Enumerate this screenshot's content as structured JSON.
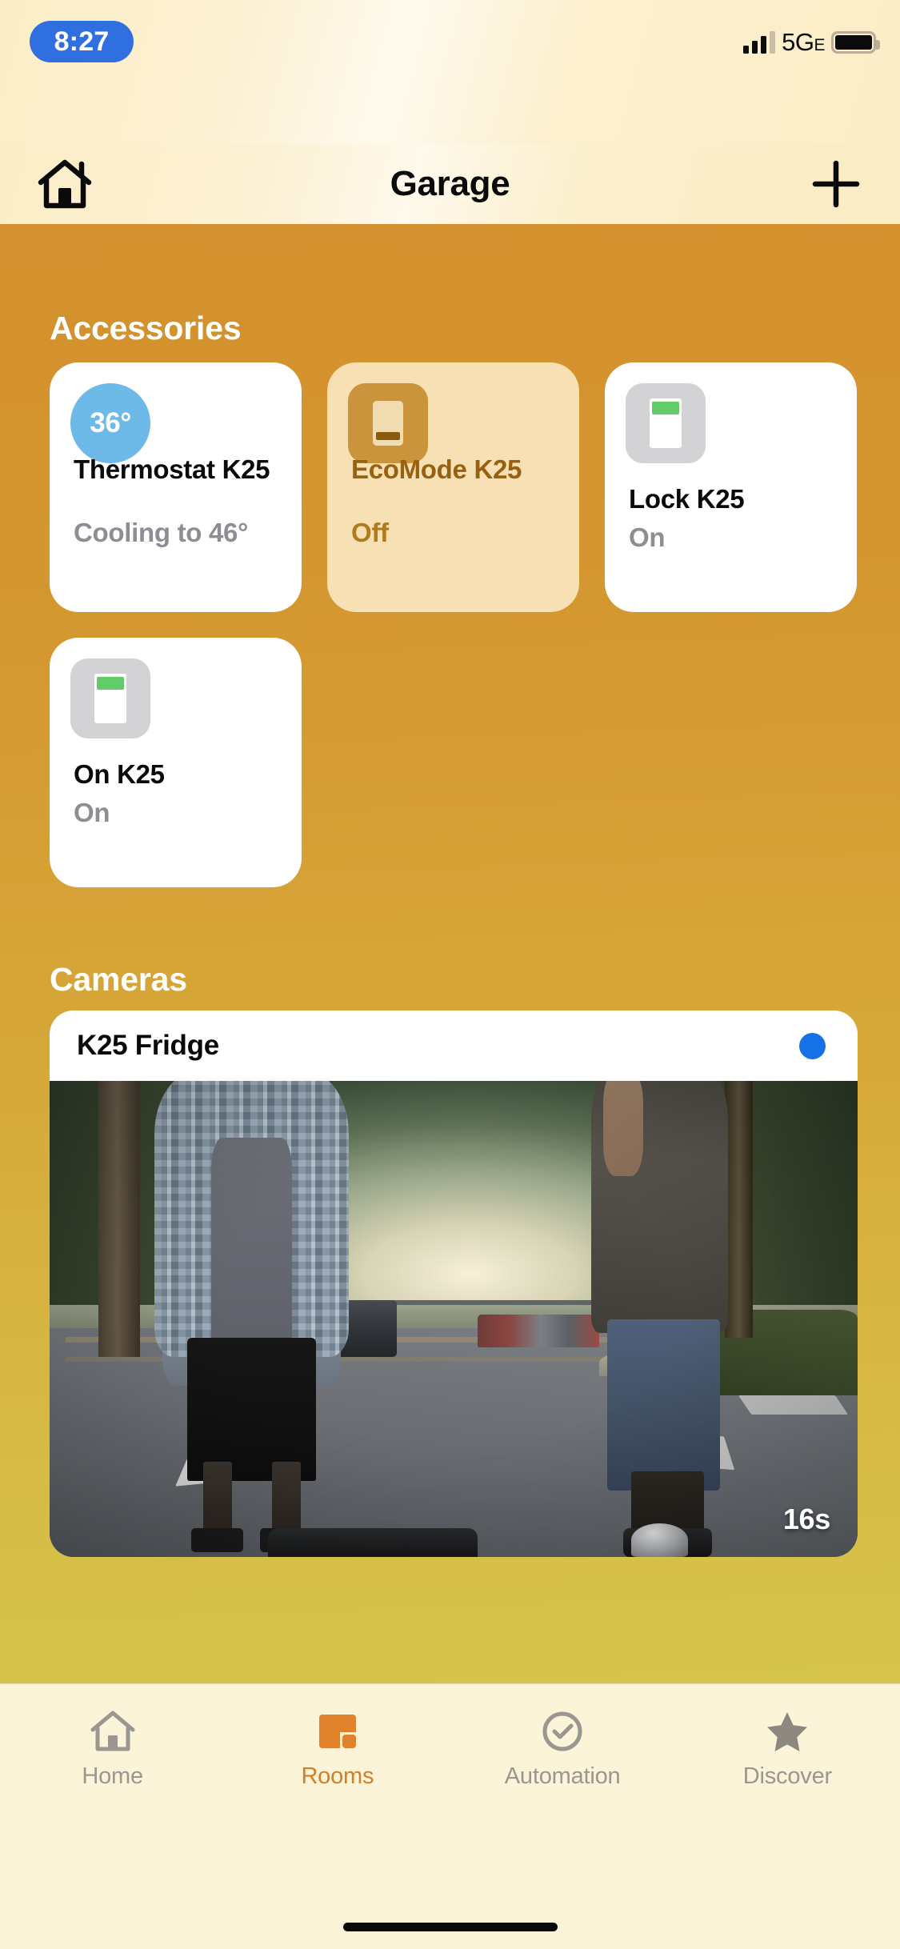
{
  "status_bar": {
    "time": "8:27",
    "time_pill_color": "#2F6FE0",
    "network": "5G",
    "network_suffix": "E",
    "signal_icon": "cellular-signal-icon",
    "battery_icon": "battery-full-icon"
  },
  "nav": {
    "home_icon": "house-icon",
    "title": "Garage",
    "add_icon": "plus-icon"
  },
  "sections": {
    "accessories_title": "Accessories",
    "cameras_title": "Cameras"
  },
  "accessories": [
    {
      "icon": "thermostat-temperature-icon",
      "icon_type": "temp",
      "temperature": "36°",
      "accent": "#6DB9E8",
      "name": "Thermostat K25",
      "status": "Cooling to 46°",
      "active": false,
      "lines": 2
    },
    {
      "icon": "ecomode-appliance-icon",
      "icon_type": "eco",
      "accent": "#C9943B",
      "name": "EcoMode K25",
      "status": "Off",
      "active": true,
      "lines": 2
    },
    {
      "icon": "wall-switch-icon",
      "icon_type": "switch",
      "accent": "#63CC6A",
      "name": "Lock K25",
      "status": "On",
      "active": false,
      "lines": 1
    },
    {
      "icon": "wall-switch-icon",
      "icon_type": "switch",
      "accent": "#63CC6A",
      "name": "On K25",
      "status": "On",
      "active": false,
      "lines": 1
    }
  ],
  "camera": {
    "name": "K25 Fridge",
    "status_dot_icon": "recording-status-dot",
    "status_dot_color": "#1472E6",
    "timestamp": "16s",
    "snapshot_alt": "forest parking lot with two people"
  },
  "tabs": [
    {
      "label": "Home",
      "icon": "house-icon",
      "selected": false
    },
    {
      "label": "Rooms",
      "icon": "rooms-squares-icon",
      "selected": true
    },
    {
      "label": "Automation",
      "icon": "automation-check-icon",
      "selected": false
    },
    {
      "label": "Discover",
      "icon": "star-icon",
      "selected": false
    }
  ],
  "theme": {
    "room_bg_top": "#D4912F",
    "room_bg_bottom": "#D6C54B",
    "accent": "#D07F27"
  }
}
